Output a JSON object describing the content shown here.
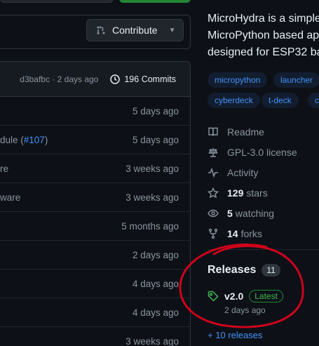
{
  "header": {
    "contribute_label": "Contribute"
  },
  "commits_bar": {
    "latest_commit": "d3bafbc · 2 days ago",
    "commits_label": "196 Commits"
  },
  "files": [
    {
      "name": "",
      "link": "",
      "suffix": "",
      "age": "5 days ago"
    },
    {
      "name": "dule (",
      "link": "#107",
      "suffix": ")",
      "age": "5 days ago"
    },
    {
      "name": "re",
      "link": "",
      "suffix": "",
      "age": "3 weeks ago"
    },
    {
      "name": "ware",
      "link": "",
      "suffix": "",
      "age": "3 weeks ago"
    },
    {
      "name": "",
      "link": "",
      "suffix": "",
      "age": "5 months ago"
    },
    {
      "name": "",
      "link": "",
      "suffix": "",
      "age": "2 days ago"
    },
    {
      "name": "",
      "link": "",
      "suffix": "",
      "age": "4 days ago"
    },
    {
      "name": "",
      "link": "",
      "suffix": "",
      "age": "4 days ago"
    },
    {
      "name": "",
      "link": "",
      "suffix": "",
      "age": "3 weeks ago"
    }
  ],
  "about": {
    "description_lines": [
      "MicroHydra is a simple",
      "MicroPython based ap",
      "designed for ESP32 ba"
    ],
    "topics": [
      "micropython",
      "launcher",
      "cyberdeck",
      "t-deck",
      "c"
    ]
  },
  "meta": {
    "readme": "Readme",
    "license": "GPL-3.0 license",
    "activity": "Activity",
    "stars_count": "129",
    "stars_label": "stars",
    "watching_count": "5",
    "watching_label": "watching",
    "forks_count": "14",
    "forks_label": "forks"
  },
  "releases": {
    "title": "Releases",
    "count": "11",
    "latest_version": "v2.0",
    "latest_badge": "Latest",
    "latest_date": "2 days ago",
    "more_link": "+ 10 releases"
  },
  "colors": {
    "background": "#0d1117",
    "link": "#4493f8",
    "muted": "#8b949e",
    "annotation": "#d0021b"
  }
}
